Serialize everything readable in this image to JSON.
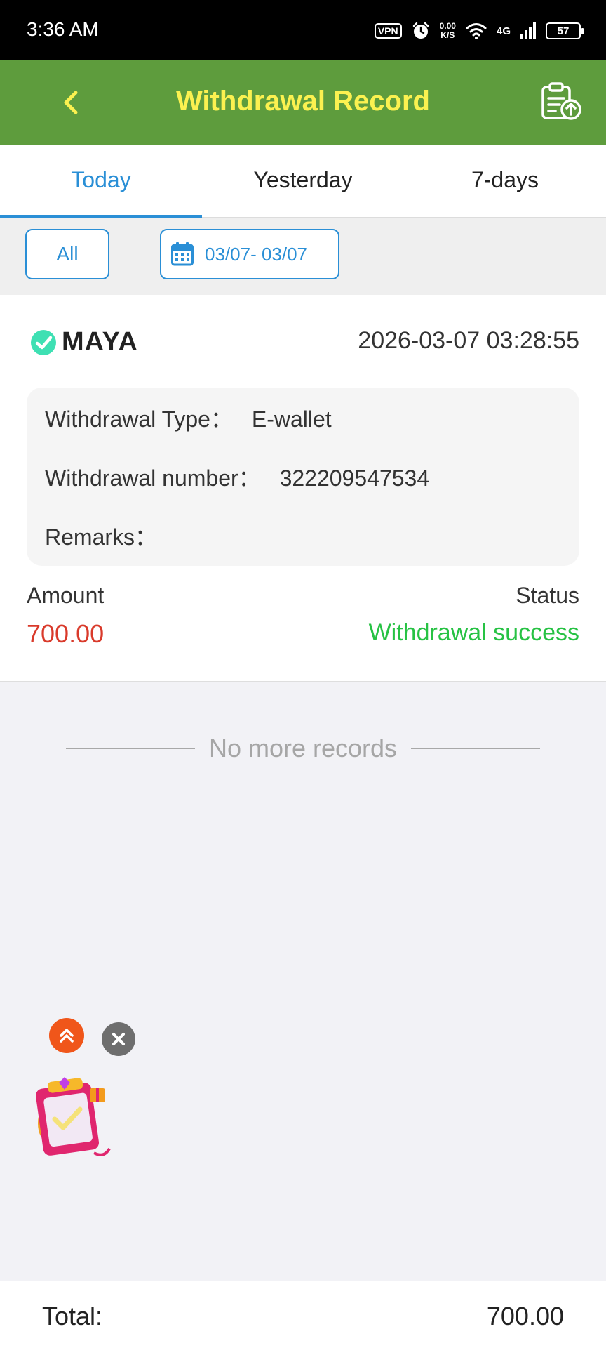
{
  "status_bar": {
    "time": "3:36 AM",
    "vpn": "VPN",
    "speed_value": "0.00",
    "speed_unit": "K/S",
    "network": "4G",
    "battery": "57"
  },
  "header": {
    "title": "Withdrawal Record",
    "title_color": "#fbf150",
    "bg_color": "#5e9c3d"
  },
  "tabs": [
    {
      "label": "Today",
      "active": true
    },
    {
      "label": "Yesterday",
      "active": false
    },
    {
      "label": "7-days",
      "active": false
    }
  ],
  "filters": {
    "all_label": "All",
    "date_range": "03/07- 03/07",
    "accent_color": "#2a8fd6"
  },
  "record": {
    "method": "MAYA",
    "datetime": "2026-03-07 03:28:55",
    "type_label": "Withdrawal Type：",
    "type_value": "E-wallet",
    "number_label": "Withdrawal number：",
    "number_value": "322209547534",
    "remarks_label": "Remarks：",
    "remarks_value": "",
    "amount_label": "Amount",
    "amount_value": "700.00",
    "status_label": "Status",
    "status_value": "Withdrawal success"
  },
  "list_end_text": "No more records",
  "footer": {
    "total_label": "Total:",
    "total_value": "700.00"
  },
  "icons": {
    "back": "chevron-left-icon",
    "upload": "clipboard-upload-icon",
    "calendar": "calendar-icon",
    "logo": "maya-logo-icon",
    "scroll_top": "double-chevron-up-icon",
    "close": "close-icon",
    "gift": "gift-promo-icon"
  }
}
